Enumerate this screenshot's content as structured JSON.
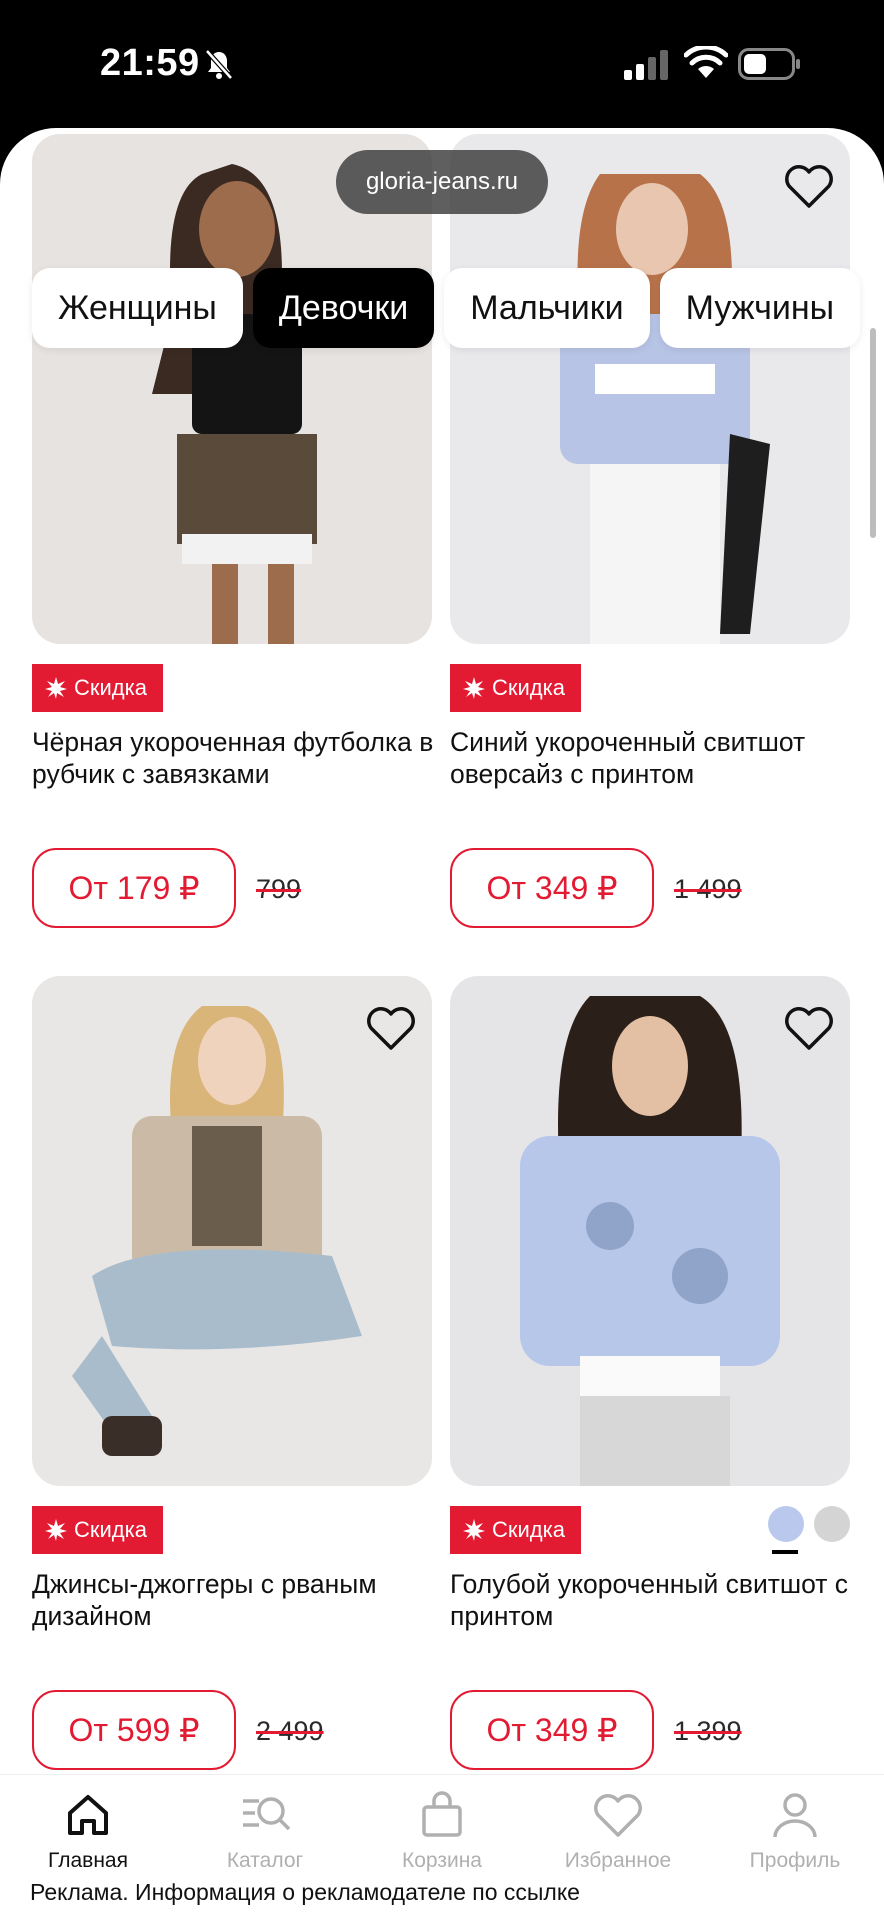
{
  "status_bar": {
    "time": "21:59"
  },
  "browser": {
    "url": "gloria-jeans.ru"
  },
  "category_tabs": [
    {
      "label": "Женщины",
      "active": false
    },
    {
      "label": "Девочки",
      "active": true
    },
    {
      "label": "Мальчики",
      "active": false
    },
    {
      "label": "Мужчины",
      "active": false
    }
  ],
  "products": [
    {
      "badge": "Скидка",
      "title": "Чёрная укороченная футболка в рубчик с завязками",
      "price": "От 179 ₽",
      "old_price": "799"
    },
    {
      "badge": "Скидка",
      "title": "Синий укороченный свитшот оверсайз с принтом",
      "price": "От 349 ₽",
      "old_price": "1 499"
    },
    {
      "badge": "Скидка",
      "title": "Джинсы-джоггеры с рваным дизайном",
      "price": "От 599 ₽",
      "old_price": "2 499"
    },
    {
      "badge": "Скидка",
      "title": "Голубой укороченный свитшот с принтом",
      "price": "От 349 ₽",
      "old_price": "1 399",
      "swatches": [
        "#b9c8ec",
        "#d4d4d4"
      ]
    }
  ],
  "bottom_nav": {
    "items": [
      {
        "label": "Главная",
        "icon": "home-icon",
        "active": true
      },
      {
        "label": "Каталог",
        "icon": "catalog-search-icon",
        "active": false
      },
      {
        "label": "Корзина",
        "icon": "cart-bag-icon",
        "active": false
      },
      {
        "label": "Избранное",
        "icon": "heart-icon",
        "active": false
      },
      {
        "label": "Профиль",
        "icon": "profile-icon",
        "active": false
      }
    ],
    "ad_notice": "Реклама. Информация о рекламодателе по ссылке"
  },
  "colors": {
    "accent": "#e21b33",
    "nav_inactive": "#b0b0b0"
  }
}
